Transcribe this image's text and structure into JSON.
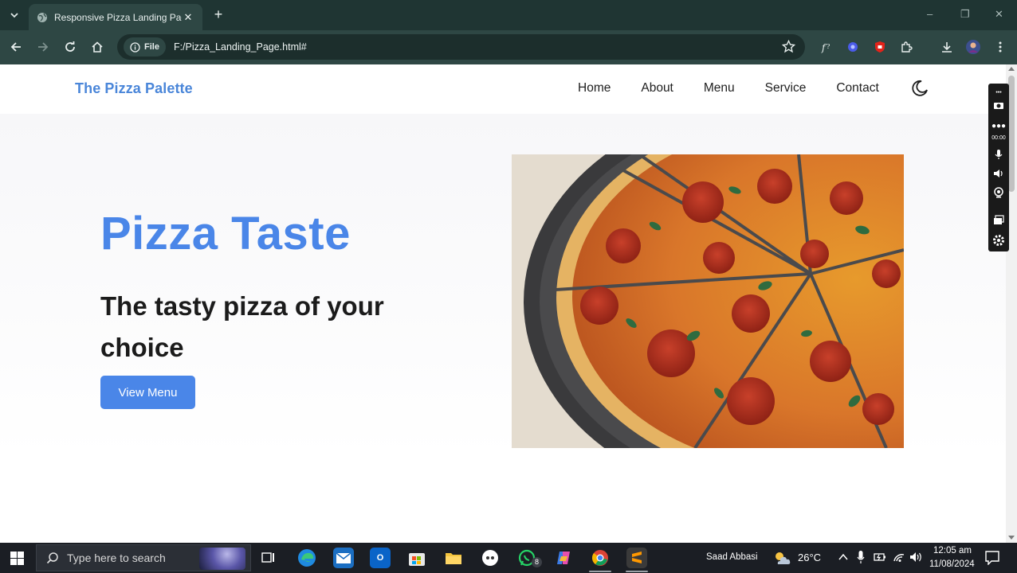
{
  "browser": {
    "tab_title": "Responsive Pizza Landing Page",
    "new_tab": "+",
    "url_scheme_label": "File",
    "url": "F:/Pizza_Landing_Page.html#",
    "window_controls": [
      "–",
      "❐",
      "✕"
    ]
  },
  "page": {
    "brand": "The Pizza Palette",
    "nav": [
      "Home",
      "About",
      "Menu",
      "Service",
      "Contact"
    ],
    "hero_title": "Pizza Taste",
    "hero_subtitle": "The tasty pizza of your choice",
    "cta_label": "View Menu"
  },
  "recorder": {
    "timer": "00:00"
  },
  "taskbar": {
    "search_placeholder": "Type here to search",
    "user_name": "Saad Abbasi",
    "weather": "26°C",
    "time": "12:05 am",
    "date": "11/08/2024",
    "whatsapp_badge": "8"
  },
  "colors": {
    "accent": "#4a86e8",
    "brand": "#4a86d9",
    "chrome_dark": "#1f3533",
    "toolbar": "#2e4744",
    "taskbar": "#1b1e24"
  }
}
